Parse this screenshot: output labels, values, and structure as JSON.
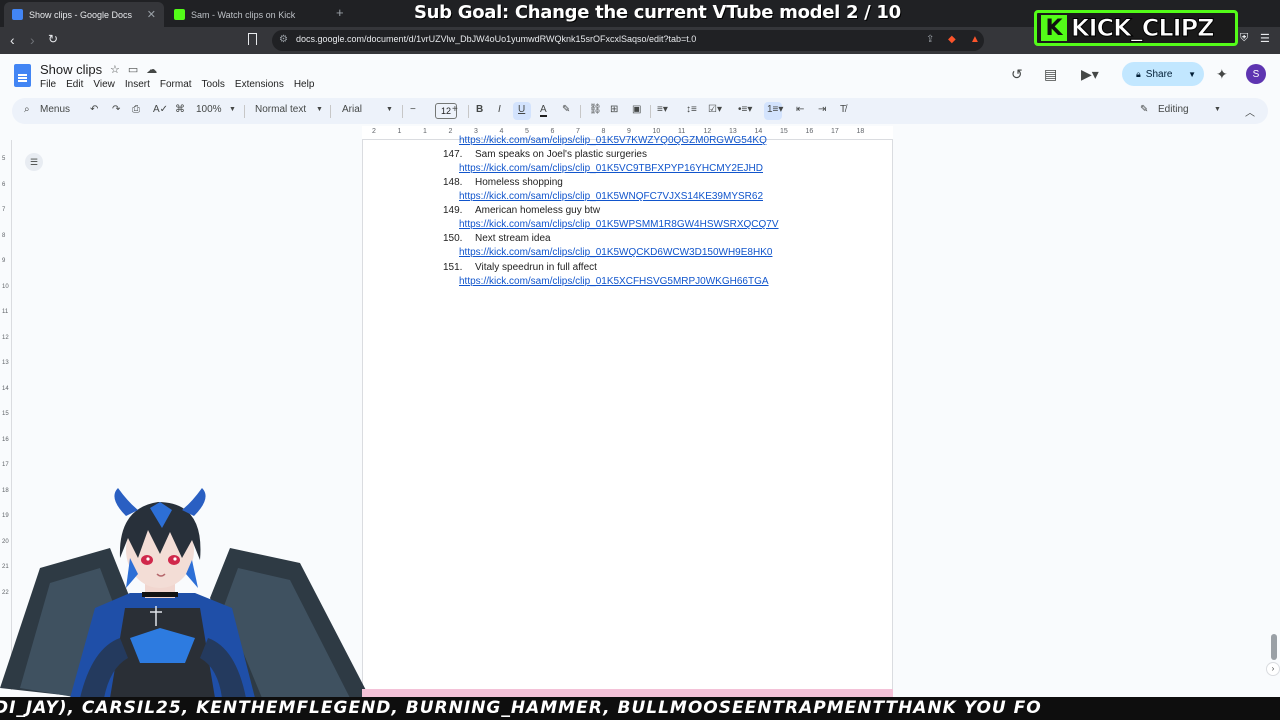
{
  "browser": {
    "tabs": [
      {
        "title": "Show clips - Google Docs",
        "active": true
      },
      {
        "title": "Sam - Watch clips on Kick",
        "active": false
      }
    ],
    "url": "docs.google.com/document/d/1vrUZVlw_DbJW4oUo1yumwdRWQknk15srOFxcxlSaqso/edit?tab=t.0"
  },
  "overlay": {
    "sub_goal": "Sub Goal: Change the current VTube model  2 / 10",
    "kick_badge_letter": "K",
    "kick_badge_name": "KICK_CLIPZ",
    "ticker": "DI_JAY), CARSIL25, KENTHEMFLEGEND, BURNING_HAMMER, BULLMOOSEENTRAPMENTTHANK YOU FO"
  },
  "docs": {
    "title": "Show clips",
    "menu": [
      "File",
      "Edit",
      "View",
      "Insert",
      "Format",
      "Tools",
      "Extensions",
      "Help"
    ],
    "share_label": "Share",
    "avatar_letter": "S",
    "toolbar": {
      "menus_label": "Menus",
      "zoom": "100%",
      "style": "Normal text",
      "font": "Arial",
      "font_size": "12",
      "mode": "Editing"
    },
    "ruler_numbers": [
      "2",
      "1",
      "1",
      "2",
      "3",
      "4",
      "5",
      "6",
      "7",
      "8",
      "9",
      "10",
      "11",
      "12",
      "13",
      "14",
      "15",
      "16",
      "17",
      "18"
    ],
    "vruler_numbers": [
      "5",
      "6",
      "7",
      "8",
      "9",
      "10",
      "11",
      "12",
      "13",
      "14",
      "15",
      "16",
      "17",
      "18",
      "19",
      "20",
      "21",
      "22"
    ],
    "partial_link": "https://kick.com/sam/clips/clip_01K5V7KWZYQ0QGZM0RGWG54KQ",
    "entries": [
      {
        "num": "147.",
        "text": "Sam speaks on Joel's plastic surgeries",
        "link": "https://kick.com/sam/clips/clip_01K5VC9TBFXPYP16YHCMY2EJHD"
      },
      {
        "num": "148.",
        "text": "Homeless shopping",
        "link": "https://kick.com/sam/clips/clip_01K5WNQFC7VJXS14KE39MYSR62"
      },
      {
        "num": "149.",
        "text": "American homeless guy btw",
        "link": "https://kick.com/sam/clips/clip_01K5WPSMM1R8GW4HSWSRXQCQ7V"
      },
      {
        "num": "150.",
        "text": "Next stream idea",
        "link": "https://kick.com/sam/clips/clip_01K5WQCKD6WCW3D150WH9E8HK0"
      },
      {
        "num": "151.",
        "text": "Vitaly speedrun in full affect",
        "link": "https://kick.com/sam/clips/clip_01K5XCFHSVG5MRPJ0WKGH66TGA"
      }
    ]
  }
}
